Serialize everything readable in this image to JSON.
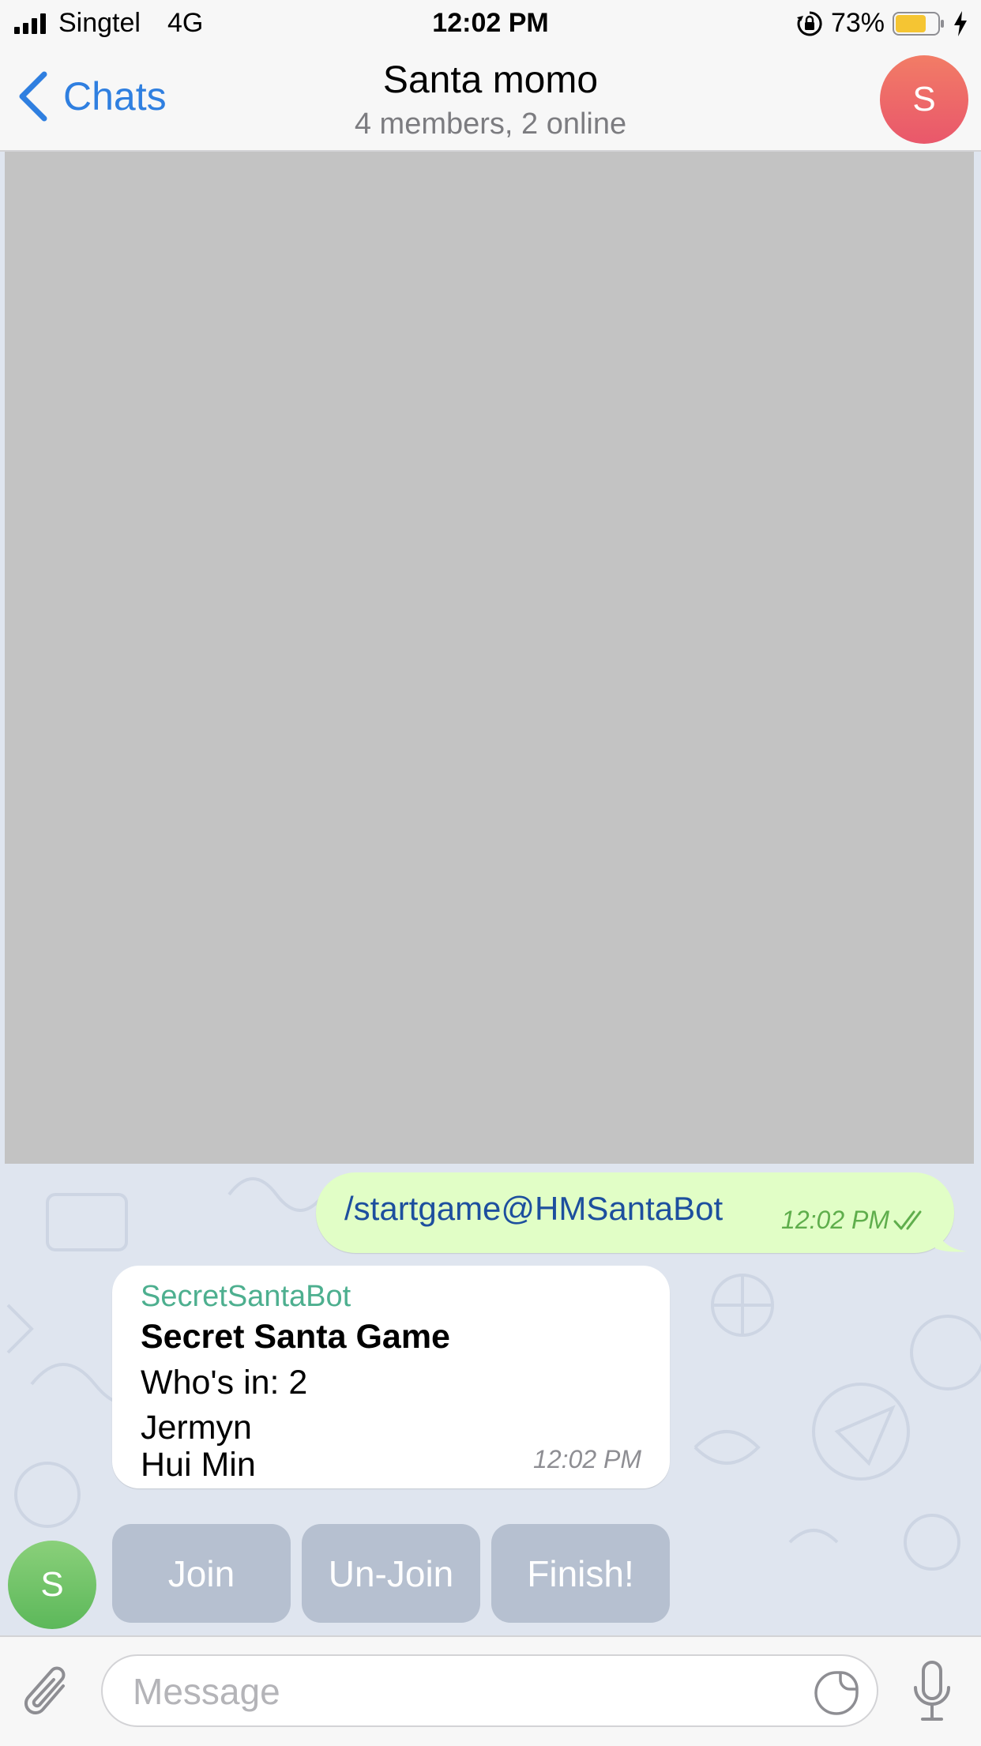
{
  "status_bar": {
    "carrier": "Singtel",
    "network": "4G",
    "time": "12:02 PM",
    "battery_percent": "73%",
    "battery_level": 0.73,
    "battery_color": "#f5c533"
  },
  "nav": {
    "back_label": "Chats",
    "title": "Santa momo",
    "subtitle": "4 members, 2 online",
    "avatar_initial": "S"
  },
  "messages": {
    "outgoing": {
      "text": "/startgame@HMSantaBot",
      "time": "12:02 PM",
      "status": "read"
    },
    "incoming": {
      "sender": "SecretSantaBot",
      "title": "Secret Santa Game",
      "lines": [
        "Who's in: 2",
        "Jermyn",
        "Hui Min"
      ],
      "time": "12:02 PM",
      "avatar_initial": "S"
    }
  },
  "inline_keyboard": {
    "buttons": [
      "Join",
      "Un-Join",
      "Finish!"
    ]
  },
  "input": {
    "placeholder": "Message"
  },
  "colors": {
    "accent": "#2f7fe0",
    "outgoing_bubble": "#e1fec6",
    "bot_name": "#4daf8f",
    "chat_background": "#dfe5ef"
  }
}
